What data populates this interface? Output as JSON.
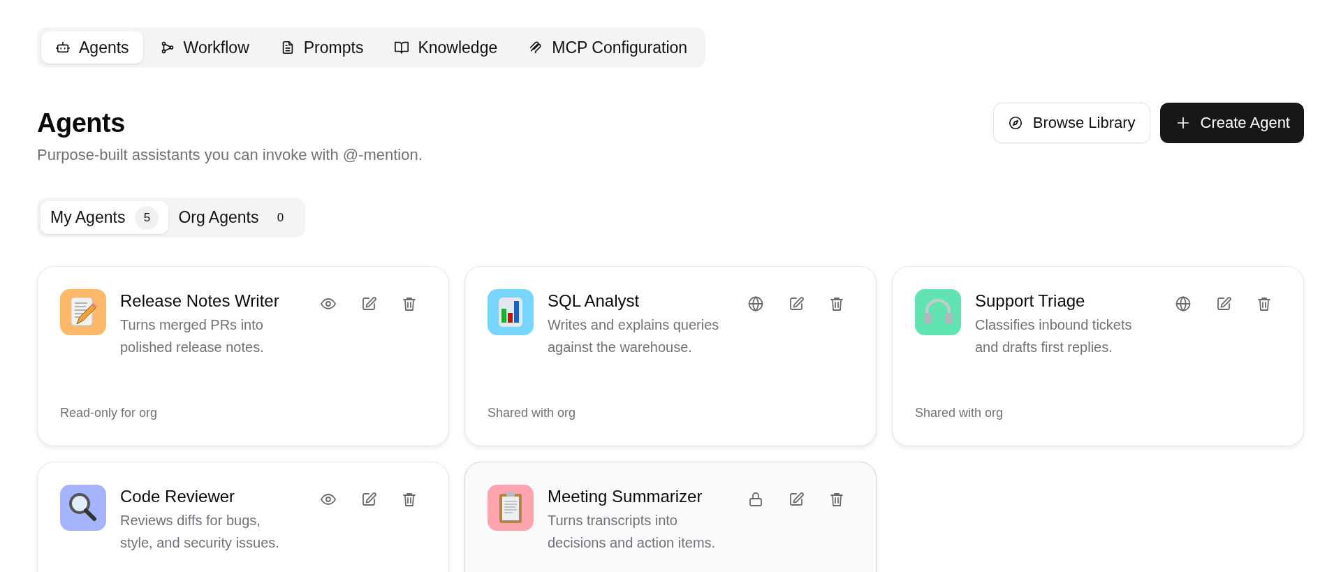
{
  "nav_tabs": [
    {
      "label": "Agents",
      "selected": true
    },
    {
      "label": "Workflow",
      "selected": false
    },
    {
      "label": "Prompts",
      "selected": false
    },
    {
      "label": "Knowledge",
      "selected": false
    },
    {
      "label": "MCP Configuration",
      "selected": false
    }
  ],
  "header": {
    "title": "Agents",
    "subtitle": "Purpose-built assistants you can invoke with @-mention.",
    "buttons": [
      {
        "label": "Browse Library",
        "kind": "secondary"
      },
      {
        "label": "Create Agent",
        "kind": "primary"
      }
    ]
  },
  "filter_tabs": [
    {
      "label": "My Agents",
      "count": "5",
      "selected": true
    },
    {
      "label": "Org Agents",
      "count": "0",
      "selected": false
    }
  ],
  "agents": [
    {
      "name": "Release Notes Writer",
      "description": "Turns merged PRs into polished release notes.",
      "kind": "readonly",
      "footer": "Read-only for org",
      "color": "#fdb86a",
      "highlighted": false
    },
    {
      "name": "SQL Analyst",
      "description": "Writes and explains queries against the warehouse.",
      "kind": "shared",
      "footer": "Shared with org",
      "color": "#78d5fb",
      "highlighted": false
    },
    {
      "name": "Support Triage",
      "description": "Classifies inbound tickets and drafts first replies.",
      "kind": "shared",
      "footer": "Shared with org",
      "color": "#62e3b2",
      "highlighted": false
    },
    {
      "name": "Code Reviewer",
      "description": "Reviews diffs for bugs, style, and security issues.",
      "kind": "readonly",
      "color": "#a6b4fb",
      "highlighted": false
    },
    {
      "name": "Meeting Summarizer",
      "description": "Turns transcripts into decisions and action items.",
      "kind": "private",
      "color": "#fda4ae",
      "highlighted": true
    }
  ]
}
